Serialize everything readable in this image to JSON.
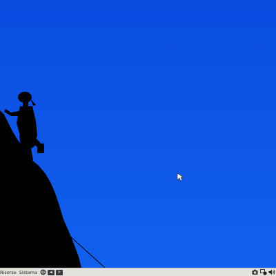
{
  "desktop": {
    "wallpaper": {
      "subject": "climber-silhouette",
      "sky_color_top": "#0a4be0",
      "sky_color_bottom": "#1260ee",
      "silhouette_color": "#000000"
    },
    "cursor_icon": "arrow-cursor-icon"
  },
  "taskbar": {
    "background": "#e2e2dd",
    "menus": [
      {
        "label": "Risorse"
      },
      {
        "label": "Sistema"
      }
    ],
    "quick_launch": [
      {
        "icon": "browser-icon"
      },
      {
        "icon": "window-list-icon",
        "glyph": "◀"
      },
      {
        "icon": "terminal-icon",
        "glyph": ">"
      }
    ],
    "tray": [
      {
        "icon": "camera-icon"
      },
      {
        "icon": "network-icon"
      },
      {
        "icon": "volume-icon"
      }
    ]
  }
}
